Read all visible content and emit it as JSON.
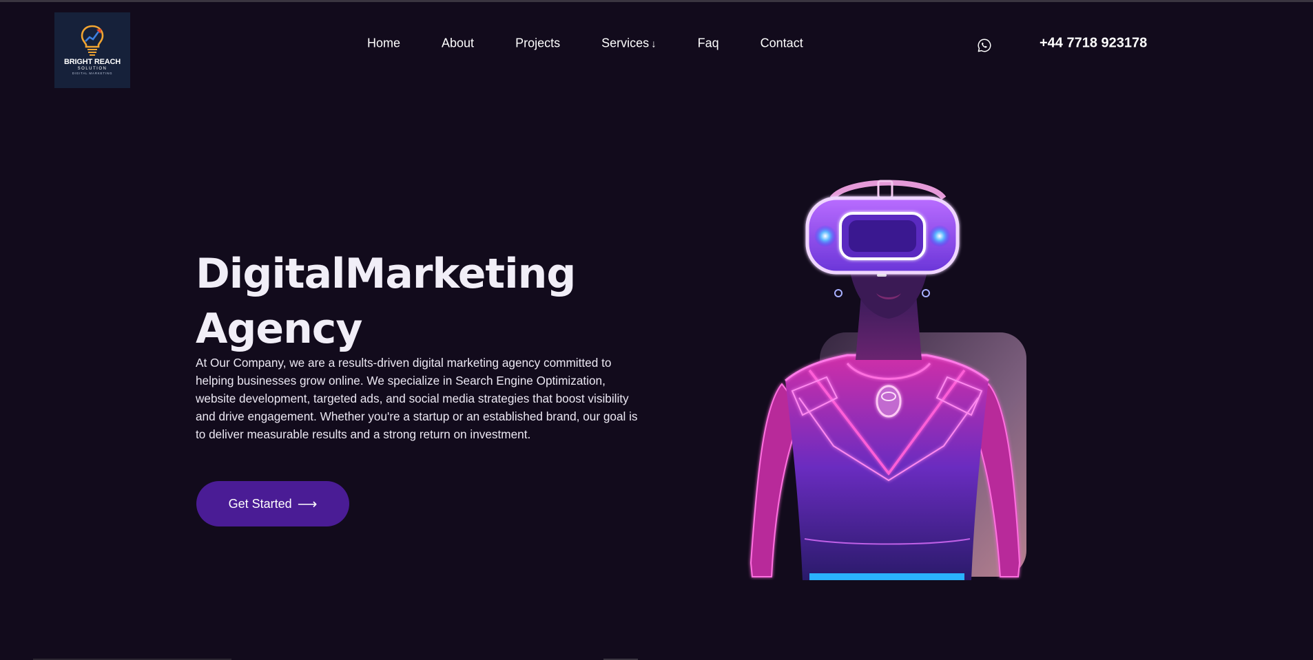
{
  "logo": {
    "title": "BRIGHT REACH",
    "subtitle": "SOLUTION",
    "tagline": "DIGITAL MARKETING"
  },
  "nav": {
    "items": [
      {
        "label": "Home"
      },
      {
        "label": "About"
      },
      {
        "label": "Projects"
      },
      {
        "label": "Services",
        "arrow": "↓"
      },
      {
        "label": "Faq"
      },
      {
        "label": "Contact"
      }
    ]
  },
  "contact": {
    "icon": "whatsapp-icon",
    "phone": "+44 7718 923178"
  },
  "hero": {
    "title_line1": "DigitalMarketing",
    "title_line2": "Agency",
    "description": "At Our Company, we are a results-driven digital marketing agency committed to helping businesses grow online. We specialize in Search Engine Optimization, website development, targeted ads, and social media strategies that boost visibility and drive engagement. Whether you're a startup or an established brand, our goal is to deliver measurable results and a strong return on investment.",
    "cta_label": "Get Started",
    "cta_arrow": "⟶",
    "image": "vr-headset-neon-figure"
  },
  "colors": {
    "background": "#120b1c",
    "cta": "#4a1c95",
    "logo_bg": "#16213a",
    "neon_pink": "#ff4fd8",
    "neon_purple": "#8a4dff"
  }
}
